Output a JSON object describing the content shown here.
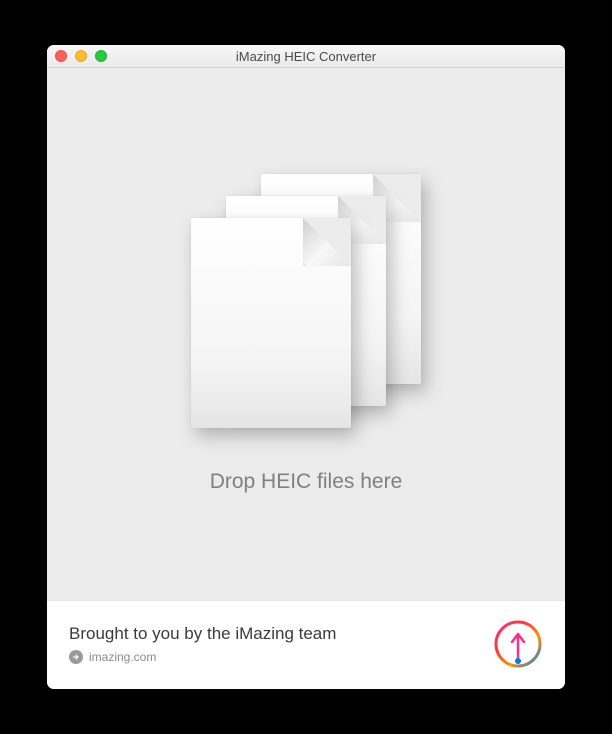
{
  "window": {
    "title": "iMazing HEIC Converter"
  },
  "drop": {
    "label": "Drop HEIC files here"
  },
  "footer": {
    "tagline": "Brought to you by the iMazing team",
    "link_label": "imazing.com"
  }
}
